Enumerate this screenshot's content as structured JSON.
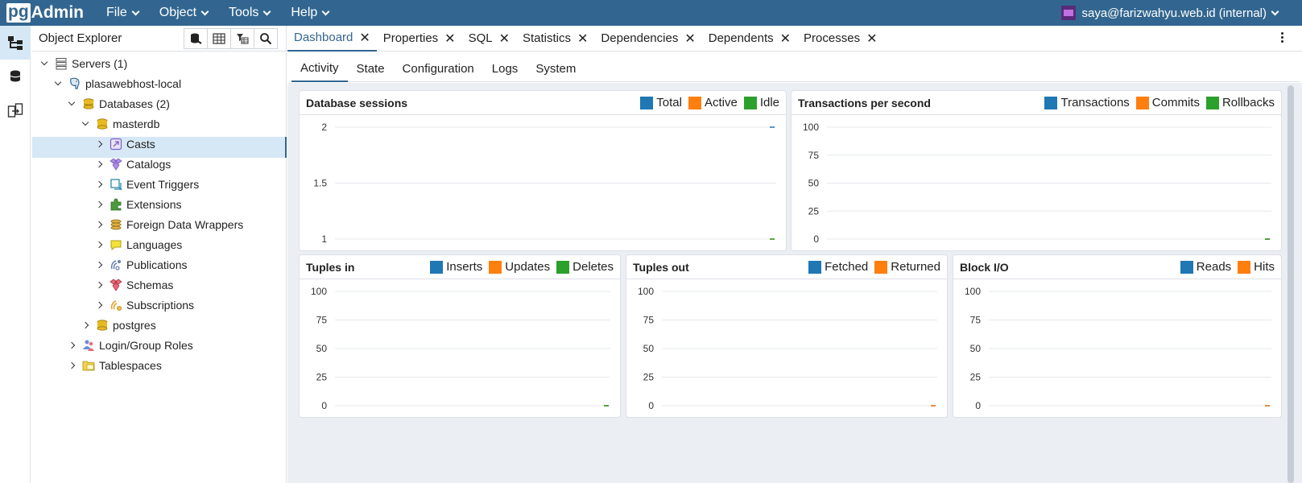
{
  "brand": {
    "pg": "pg",
    "admin": "Admin"
  },
  "menu": [
    {
      "label": "File"
    },
    {
      "label": "Object"
    },
    {
      "label": "Tools"
    },
    {
      "label": "Help"
    }
  ],
  "user": {
    "label": "saya@farizwahyu.web.id (internal)"
  },
  "explorer": {
    "title": "Object Explorer"
  },
  "tree": [
    {
      "label": "Servers",
      "count": "(1)"
    },
    {
      "label": "plasawebhost-local"
    },
    {
      "label": "Databases",
      "count": "(2)"
    },
    {
      "label": "masterdb"
    },
    {
      "label": "Casts"
    },
    {
      "label": "Catalogs"
    },
    {
      "label": "Event Triggers"
    },
    {
      "label": "Extensions"
    },
    {
      "label": "Foreign Data Wrappers"
    },
    {
      "label": "Languages"
    },
    {
      "label": "Publications"
    },
    {
      "label": "Schemas"
    },
    {
      "label": "Subscriptions"
    },
    {
      "label": "postgres"
    },
    {
      "label": "Login/Group Roles"
    },
    {
      "label": "Tablespaces"
    }
  ],
  "tabs": [
    {
      "label": "Dashboard"
    },
    {
      "label": "Properties"
    },
    {
      "label": "SQL"
    },
    {
      "label": "Statistics"
    },
    {
      "label": "Dependencies"
    },
    {
      "label": "Dependents"
    },
    {
      "label": "Processes"
    }
  ],
  "subtabs": [
    {
      "label": "Activity"
    },
    {
      "label": "State"
    },
    {
      "label": "Configuration"
    },
    {
      "label": "Logs"
    },
    {
      "label": "System"
    }
  ],
  "colors": {
    "blue": "#1f77b4",
    "orange": "#ff7f0e",
    "green": "#2ca02c",
    "accent": "#326690"
  },
  "chart_data": [
    {
      "type": "line",
      "title": "Database sessions",
      "ylim": [
        1,
        2
      ],
      "yticks": [
        "2",
        "1.5",
        "1"
      ],
      "series": [
        {
          "name": "Total",
          "values": [
            2
          ]
        },
        {
          "name": "Active",
          "values": [
            1
          ]
        },
        {
          "name": "Idle",
          "values": [
            1
          ]
        }
      ]
    },
    {
      "type": "line",
      "title": "Transactions per second",
      "ylim": [
        0,
        100
      ],
      "yticks": [
        "100",
        "75",
        "50",
        "25",
        "0"
      ],
      "series": [
        {
          "name": "Transactions",
          "values": [
            0
          ]
        },
        {
          "name": "Commits",
          "values": [
            0
          ]
        },
        {
          "name": "Rollbacks",
          "values": [
            0
          ]
        }
      ]
    },
    {
      "type": "line",
      "title": "Tuples in",
      "ylim": [
        0,
        100
      ],
      "yticks": [
        "100",
        "75",
        "50",
        "25",
        "0"
      ],
      "series": [
        {
          "name": "Inserts",
          "values": [
            0
          ]
        },
        {
          "name": "Updates",
          "values": [
            0
          ]
        },
        {
          "name": "Deletes",
          "values": [
            0
          ]
        }
      ]
    },
    {
      "type": "line",
      "title": "Tuples out",
      "ylim": [
        0,
        100
      ],
      "yticks": [
        "100",
        "75",
        "50",
        "25",
        "0"
      ],
      "series": [
        {
          "name": "Fetched",
          "values": [
            0
          ]
        },
        {
          "name": "Returned",
          "values": [
            0
          ]
        }
      ]
    },
    {
      "type": "line",
      "title": "Block I/O",
      "ylim": [
        0,
        100
      ],
      "yticks": [
        "100",
        "75",
        "50",
        "25",
        "0"
      ],
      "series": [
        {
          "name": "Reads",
          "values": [
            0
          ]
        },
        {
          "name": "Hits",
          "values": [
            0
          ]
        }
      ]
    }
  ]
}
